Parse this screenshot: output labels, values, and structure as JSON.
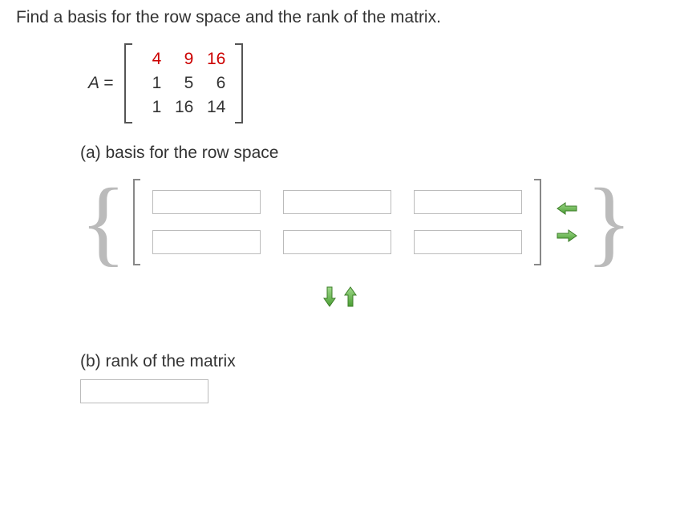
{
  "question": "Find a basis for the row space and the rank of the matrix.",
  "matrix_label": "A =",
  "matrix": {
    "rows": [
      {
        "c0": "4",
        "c1": "9",
        "c2": "16"
      },
      {
        "c0": "1",
        "c1": "5",
        "c2": "6"
      },
      {
        "c0": "1",
        "c1": "16",
        "c2": "14"
      }
    ],
    "highlighted_row": 0
  },
  "part_a": {
    "label": "(a) basis for the row space"
  },
  "part_b": {
    "label": "(b) rank of the matrix"
  },
  "icons": {
    "arrow_left": "arrow-left",
    "arrow_right": "arrow-right",
    "arrow_down": "arrow-down",
    "arrow_up": "arrow-up"
  }
}
